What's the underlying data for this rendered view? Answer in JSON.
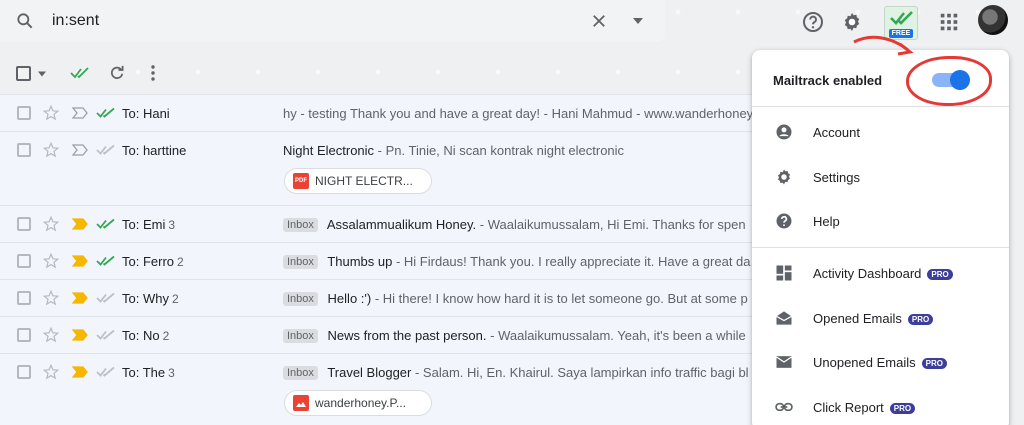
{
  "search": {
    "query": "in:sent"
  },
  "header": {
    "mailtrack_badge_text": "FREE"
  },
  "toolbar": {},
  "emails": [
    {
      "sender": "To: Hani",
      "count": "",
      "label": "",
      "subject": "",
      "snippet": "hy - testing Thank you and have a great day! - Hani Mahmud - www.wanderhoney",
      "important": false,
      "double_check": "green"
    },
    {
      "sender": "To: harttine",
      "count": "",
      "label": "",
      "subject": "Night Electronic",
      "snippet": " - Pn. Tinie, Ni scan kontrak night electronic",
      "important": false,
      "double_check": "gray",
      "attachment": {
        "name": "NIGHT ELECTR...",
        "type": "pdf"
      }
    },
    {
      "sender": "To: Emi",
      "count": "3",
      "label": "Inbox",
      "subject": "Assalammualikum Honey.",
      "snippet": " - Waalaikumussalam, Hi Emi. Thanks for spen",
      "important": true,
      "double_check": "green"
    },
    {
      "sender": "To: Ferro",
      "count": "2",
      "label": "Inbox",
      "subject": "Thumbs up",
      "snippet": " - Hi Firdaus! Thank you. I really appreciate it. Have a great da",
      "important": true,
      "double_check": "green"
    },
    {
      "sender": "To: Why",
      "count": "2",
      "label": "Inbox",
      "subject": "Hello :')",
      "snippet": " - Hi there! I know how hard it is to let someone go. But at some p",
      "important": true,
      "double_check": "gray"
    },
    {
      "sender": "To: No",
      "count": "2",
      "label": "Inbox",
      "subject": "News from the past person.",
      "snippet": " - Waalaikumussalam. Yeah, it's been a while",
      "important": true,
      "double_check": "gray"
    },
    {
      "sender": "To: The",
      "count": "3",
      "label": "Inbox",
      "subject": "Travel Blogger",
      "snippet": " - Salam. Hi, En. Khairul. Saya lampirkan info traffic bagi bl",
      "important": true,
      "double_check": "gray",
      "attachment": {
        "name": "wanderhoney.P...",
        "type": "image"
      }
    }
  ],
  "menu": {
    "enabled_label": "Mailtrack enabled",
    "enabled": true,
    "group1": [
      {
        "label": "Account",
        "icon": "account-icon"
      },
      {
        "label": "Settings",
        "icon": "gear-icon"
      },
      {
        "label": "Help",
        "icon": "help-icon"
      }
    ],
    "group2": [
      {
        "label": "Activity Dashboard",
        "icon": "dashboard-icon",
        "pro": "PRO"
      },
      {
        "label": "Opened Emails",
        "icon": "opened-mail-icon",
        "pro": "PRO"
      },
      {
        "label": "Unopened Emails",
        "icon": "unopened-mail-icon",
        "pro": "PRO"
      },
      {
        "label": "Click Report",
        "icon": "link-icon",
        "pro": "PRO"
      }
    ]
  },
  "colors": {
    "accent": "#1a73e8",
    "check_green": "#34a853",
    "important": "#f6b700",
    "annotation": "#e53935",
    "pro_badge": "#3c3e9a"
  }
}
